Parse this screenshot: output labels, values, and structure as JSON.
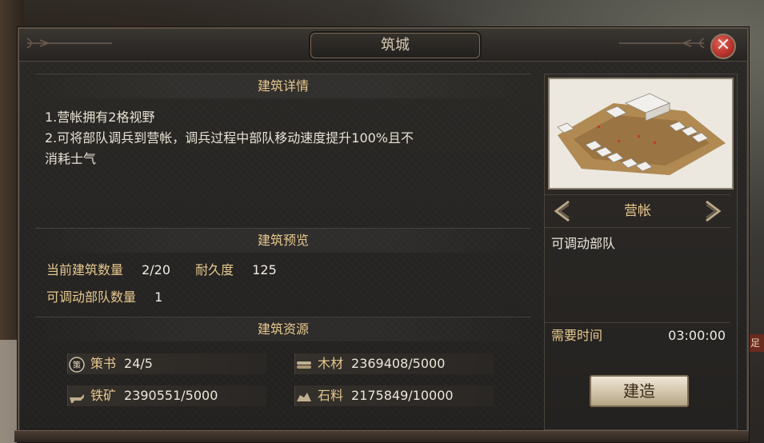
{
  "dialog": {
    "title": "筑城",
    "close_glyph": "✕"
  },
  "details": {
    "heading": "建筑详情",
    "lines": [
      "1.营帐拥有2格视野",
      "2.可将部队调兵到营帐，调兵过程中部队移动速度提升100%且不",
      "消耗士气"
    ]
  },
  "preview": {
    "heading": "建筑预览",
    "count_label": "当前建筑数量",
    "count_value": "2/20",
    "durability_label": "耐久度",
    "durability_value": "125",
    "troops_label": "可调动部队数量",
    "troops_value": "1"
  },
  "resources": {
    "heading": "建筑资源",
    "items": [
      {
        "icon": "policy-book-icon",
        "label": "策书",
        "value": "24/5"
      },
      {
        "icon": "wood-icon",
        "label": "木材",
        "value": "2369408/5000"
      },
      {
        "icon": "iron-ore-icon",
        "label": "铁矿",
        "value": "2390551/5000"
      },
      {
        "icon": "stone-icon",
        "label": "石料",
        "value": "2175849/10000"
      }
    ],
    "policy_icon_glyph": "策"
  },
  "building": {
    "name": "营帐",
    "description": "可调动部队",
    "time_label": "需要时间",
    "time_value": "03:00:00",
    "build_label": "建造"
  },
  "background": {
    "corner_tag": "足"
  },
  "colors": {
    "accent_gold": "#e6c88e",
    "close_red": "#b8352d"
  }
}
